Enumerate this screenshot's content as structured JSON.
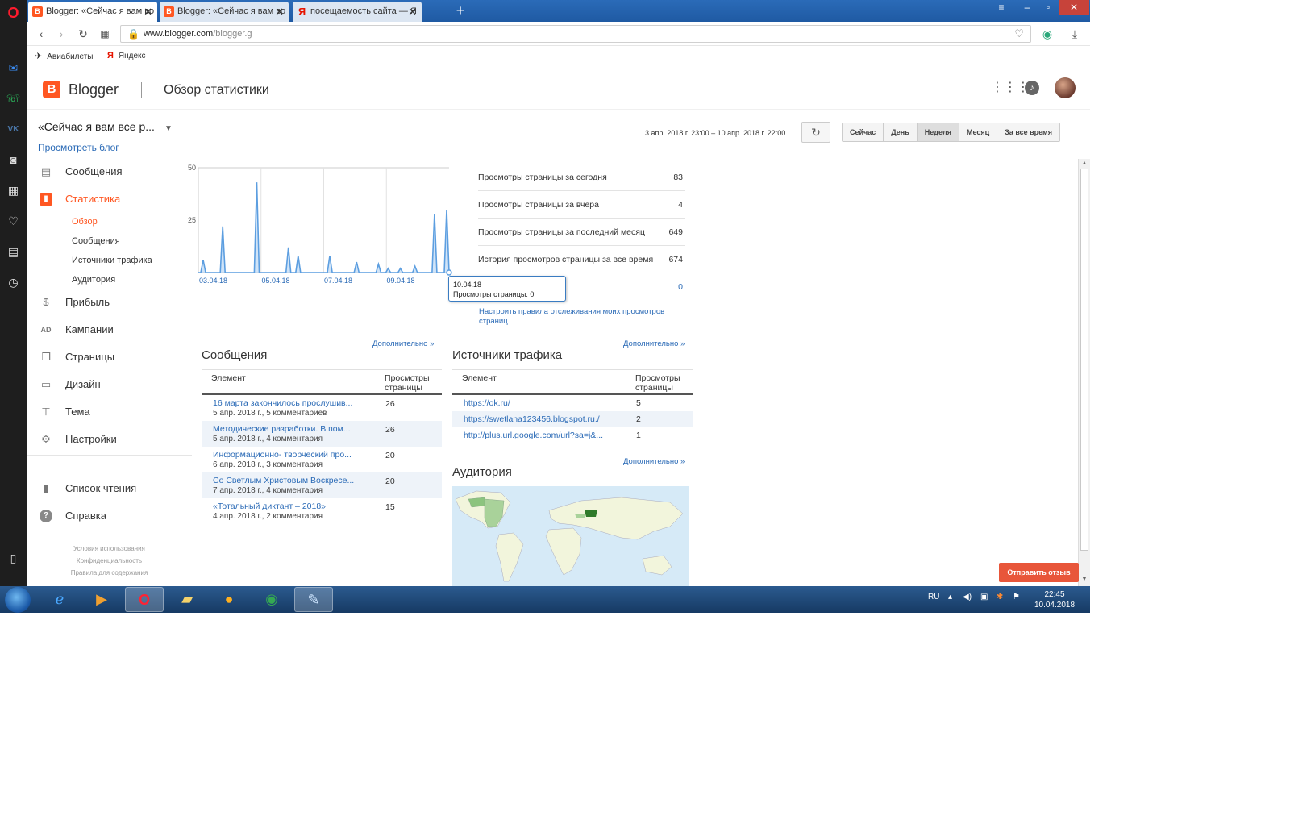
{
  "browser": {
    "tabs": [
      {
        "label": "Blogger: «Сейчас я вам во",
        "favicon": "blogger-favicon"
      },
      {
        "label": "Blogger: «Сейчас я вам во",
        "favicon": "blogger-favicon"
      },
      {
        "label": "посещаемость сайта — Я",
        "favicon": "yandex-favicon"
      }
    ],
    "url_host": "www.blogger.com",
    "url_path": "/blogger.g",
    "bookmarks": [
      "Авиабилеты",
      "Яндекс"
    ]
  },
  "header": {
    "brand": "Blogger",
    "page_title": "Обзор статистики",
    "logo_letter": "B"
  },
  "sidebar": {
    "blog_name": "«Сейчас я вам все р...",
    "view_blog": "Просмотреть блог",
    "items": [
      {
        "label": "Сообщения",
        "icon": "posts-icon"
      },
      {
        "label": "Статистика",
        "icon": "stats-icon",
        "active": true
      },
      {
        "label": "Прибыль",
        "icon": "dollar-icon"
      },
      {
        "label": "Кампании",
        "icon": "ad-icon"
      },
      {
        "label": "Страницы",
        "icon": "pages-icon"
      },
      {
        "label": "Дизайн",
        "icon": "layout-icon"
      },
      {
        "label": "Тема",
        "icon": "paint-roller-icon"
      },
      {
        "label": "Настройки",
        "icon": "gear-icon"
      },
      {
        "label": "Список чтения",
        "icon": "bookmark-icon"
      },
      {
        "label": "Справка",
        "icon": "help-icon"
      }
    ],
    "subitems": [
      "Обзор",
      "Сообщения",
      "Источники трафика",
      "Аудитория"
    ],
    "footer": [
      "Условия использования",
      "Конфиденциальность",
      "Правила для содержания"
    ]
  },
  "controls": {
    "date_range": "3 апр. 2018 г. 23:00 – 10 апр. 2018 г. 22:00",
    "ranges": [
      "Сейчас",
      "День",
      "Неделя",
      "Месяц",
      "За все время"
    ],
    "selected_range": "Неделя"
  },
  "chart_data": {
    "type": "area",
    "x_labels": [
      "03.04.18",
      "05.04.18",
      "07.04.18",
      "09.04.18",
      "10.0"
    ],
    "y_ticks": [
      50,
      25
    ],
    "ylim": [
      0,
      50
    ],
    "color": "#5c9ee0",
    "values": [
      0,
      0,
      6,
      0,
      0,
      0,
      0,
      0,
      0,
      0,
      22,
      0,
      0,
      0,
      0,
      0,
      0,
      0,
      0,
      0,
      0,
      0,
      0,
      0,
      43,
      0,
      0,
      0,
      0,
      0,
      0,
      0,
      0,
      0,
      0,
      0,
      0,
      12,
      0,
      0,
      0,
      8,
      0,
      0,
      0,
      0,
      0,
      0,
      0,
      0,
      0,
      0,
      0,
      0,
      8,
      0,
      0,
      0,
      0,
      0,
      0,
      0,
      0,
      0,
      0,
      5,
      0,
      0,
      0,
      0,
      0,
      0,
      0,
      0,
      4,
      0,
      0,
      0,
      2,
      0,
      0,
      0,
      0,
      2,
      0,
      0,
      0,
      0,
      0,
      3,
      0,
      0,
      0,
      0,
      0,
      0,
      0,
      28,
      0,
      0,
      0,
      0,
      30,
      0
    ]
  },
  "tooltip": {
    "date": "10.04.18",
    "text": "Просмотры страницы: 0"
  },
  "stats": [
    {
      "label": "Просмотры страницы за сегодня",
      "value": "83"
    },
    {
      "label": "Просмотры страницы за вчера",
      "value": "4"
    },
    {
      "label": "Просмотры страницы за последний месяц",
      "value": "649"
    },
    {
      "label": "История просмотров страницы за все время",
      "value": "674"
    },
    {
      "label": "",
      "value": "0"
    }
  ],
  "track_link": "Настроить правила отслеживания моих просмотров страниц",
  "posts": {
    "title": "Сообщения",
    "more": "Дополнительно »",
    "col_element": "Элемент",
    "col_views_1": "Просмотры",
    "col_views_2": "страницы",
    "rows": [
      {
        "title": "16 марта закончилось прослушив...",
        "meta": "5 апр. 2018 г., 5 комментариев",
        "views": "26"
      },
      {
        "title": "Методические разработки. В пом...",
        "meta": "5 апр. 2018 г., 4 комментария",
        "views": "26"
      },
      {
        "title": "Информационно- творческий про...",
        "meta": "6 апр. 2018 г., 3 комментария",
        "views": "20"
      },
      {
        "title": "Со Светлым Христовым Воскресе...",
        "meta": "7 апр. 2018 г., 4 комментария",
        "views": "20"
      },
      {
        "title": "«Тотальный диктант – 2018»",
        "meta": "4 апр. 2018 г., 2 комментария",
        "views": "15"
      }
    ]
  },
  "sources": {
    "title": "Источники трафика",
    "more": "Дополнительно »",
    "col_element": "Элемент",
    "col_views_1": "Просмотры",
    "col_views_2": "страницы",
    "rows": [
      {
        "url": "https://ok.ru/",
        "views": "5"
      },
      {
        "url": "https://swetlana123456.blogspot.ru./",
        "views": "2"
      },
      {
        "url": "http://plus.url.google.com/url?sa=j&...",
        "views": "1"
      }
    ]
  },
  "audience": {
    "title": "Аудитория",
    "more": "Дополнительно »"
  },
  "feedback": "Отправить отзыв",
  "taskbar": {
    "lang": "RU",
    "time": "22:45",
    "date": "10.04.2018"
  }
}
